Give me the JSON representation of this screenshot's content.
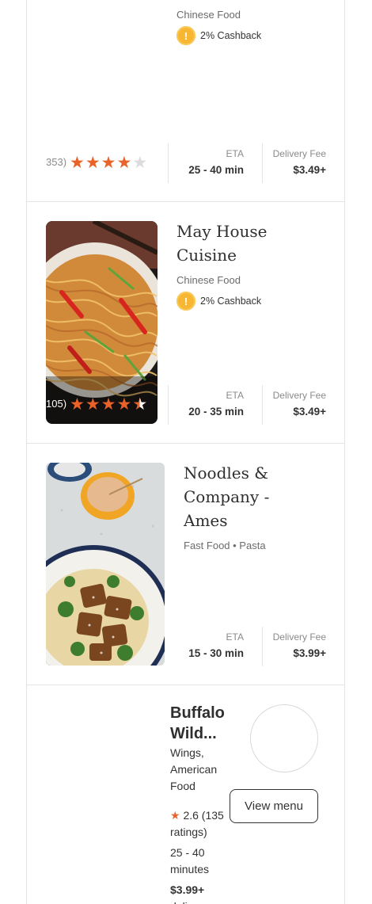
{
  "colors": {
    "star": "#e8622a",
    "star_empty": "#dcdcdc",
    "coin": "#f7b733",
    "divider": "#e4e4e4"
  },
  "restaurants": [
    {
      "cuisine": "Chinese Food",
      "cashback": "2% Cashback",
      "rating_count": "353)",
      "stars": 4,
      "eta_label": "ETA",
      "eta": "25 - 40 min",
      "fee_label": "Delivery Fee",
      "fee": "$3.49+"
    },
    {
      "name_line1": "May House",
      "name_line2": "Cuisine",
      "cuisine": "Chinese Food",
      "cashback": "2% Cashback",
      "rating_count": "105)",
      "stars": 4.5,
      "eta_label": "ETA",
      "eta": "20 - 35 min",
      "fee_label": "Delivery Fee",
      "fee": "$3.49+"
    },
    {
      "name_line1": "Noodles &",
      "name_line2": "Company -",
      "name_line3": "Ames",
      "cuisine": "Fast Food • Pasta",
      "eta_label": "ETA",
      "eta": "15 - 30 min",
      "fee_label": "Delivery Fee",
      "fee": "$3.99+"
    },
    {
      "name_line1": "Buffalo",
      "name_line2": "Wild...",
      "cuisine_line1": "Wings,",
      "cuisine_line2": "American",
      "cuisine_line3": "Food",
      "rating_text": "2.6 (135",
      "rating_text2": "ratings)",
      "eta_line1": "25 - 40",
      "eta_line2": "minutes",
      "fee": "$3.99+",
      "fee_line2": "delivery",
      "view_menu": "View menu"
    }
  ]
}
